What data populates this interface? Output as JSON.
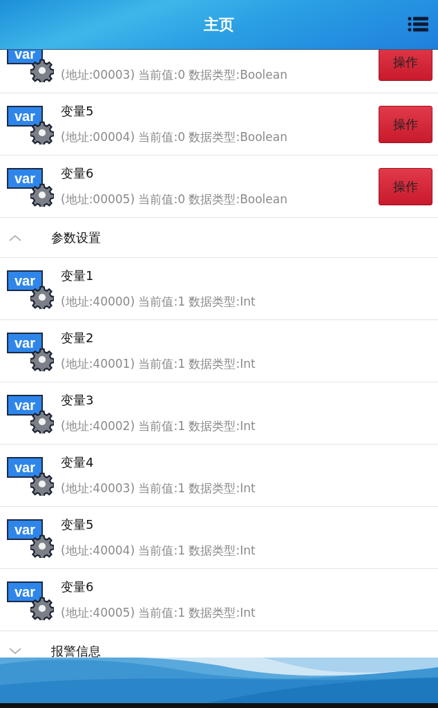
{
  "header": {
    "title": "主页"
  },
  "items": [
    {
      "kind": "variable",
      "icon_text": "var",
      "detail": "(地址:00003) 当前值:0 数据类型:Boolean",
      "action": "操作"
    },
    {
      "kind": "variable",
      "icon_text": "var",
      "name": "变量5",
      "detail": "(地址:00004) 当前值:0 数据类型:Boolean",
      "action": "操作"
    },
    {
      "kind": "variable",
      "icon_text": "var",
      "name": "变量6",
      "detail": "(地址:00005) 当前值:0 数据类型:Boolean",
      "action": "操作"
    },
    {
      "kind": "section",
      "title": "参数设置",
      "expanded": true
    },
    {
      "kind": "variable",
      "icon_text": "var",
      "name": "变量1",
      "detail": "(地址:40000) 当前值:1 数据类型:Int"
    },
    {
      "kind": "variable",
      "icon_text": "var",
      "name": "变量2",
      "detail": "(地址:40001) 当前值:1 数据类型:Int"
    },
    {
      "kind": "variable",
      "icon_text": "var",
      "name": "变量3",
      "detail": "(地址:40002) 当前值:1 数据类型:Int"
    },
    {
      "kind": "variable",
      "icon_text": "var",
      "name": "变量4",
      "detail": "(地址:40003) 当前值:1 数据类型:Int"
    },
    {
      "kind": "variable",
      "icon_text": "var",
      "name": "变量5",
      "detail": "(地址:40004) 当前值:1 数据类型:Int"
    },
    {
      "kind": "variable",
      "icon_text": "var",
      "name": "变量6",
      "detail": "(地址:40005) 当前值:1 数据类型:Int"
    },
    {
      "kind": "section",
      "title": "报警信息",
      "expanded": false
    }
  ]
}
